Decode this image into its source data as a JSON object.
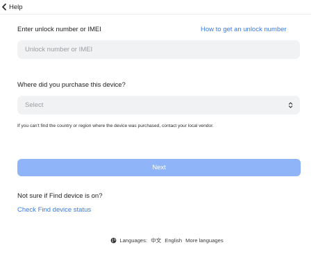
{
  "header": {
    "back_label": "Help"
  },
  "unlock": {
    "label": "Enter unlock number or IMEI",
    "help_link": "How to get an unlock number",
    "placeholder": "Unlock number or IMEI",
    "value": ""
  },
  "purchase": {
    "label": "Where did you purchase this device?",
    "selected": "Select",
    "hint": "If you can't find the country or region where the device was purchased, contact your local vendor."
  },
  "next_button": "Next",
  "find_device": {
    "question": "Not sure if Find device is on?",
    "link": "Check Find device status"
  },
  "footer": {
    "languages_label": "Languages:",
    "lang_chinese": "中文",
    "lang_english": "English",
    "more_languages": "More languages"
  },
  "colors": {
    "link": "#3a7be0",
    "button": "#8fb4f7",
    "field_bg": "#f1f2f4"
  },
  "icons": [
    "chevron-left-icon",
    "select-chevron-icon",
    "globe-icon"
  ]
}
